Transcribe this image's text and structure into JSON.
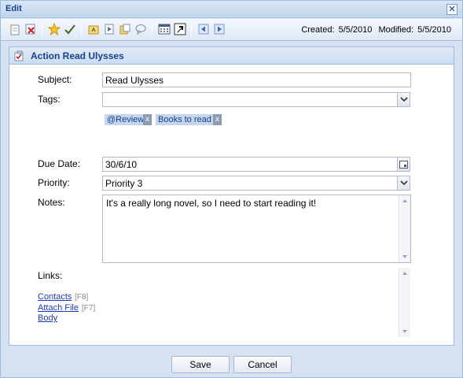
{
  "window": {
    "title": "Edit",
    "close_glyph": "✕"
  },
  "toolbar": {
    "buttons": [
      "new-item-icon",
      "delete-icon",
      "star-icon",
      "check-icon",
      "folder-up-icon",
      "move-icon",
      "copy-icon",
      "comment-icon",
      "calendar-icon",
      "external-link-icon",
      "back-icon",
      "forward-icon"
    ],
    "created_label": "Created:",
    "created_value": "5/5/2010",
    "modified_label": "Modified:",
    "modified_value": "5/5/2010"
  },
  "panel": {
    "title": "Action Read Ulysses",
    "icon": "action-icon"
  },
  "form": {
    "subject_label": "Subject:",
    "subject_value": "Read Ulysses",
    "tags_label": "Tags:",
    "tags_value": "",
    "tags": [
      {
        "label": "@Review",
        "remove": "x"
      },
      {
        "label": "Books to read",
        "remove": "x"
      }
    ],
    "due_label": "Due Date:",
    "due_value": "30/6/10",
    "priority_label": "Priority:",
    "priority_value": "Priority 3",
    "notes_label": "Notes:",
    "notes_value": "It's a really long novel, so I need to start reading it!",
    "links_label": "Links:"
  },
  "links": [
    {
      "label": "Contacts",
      "shortcut": "[F8]"
    },
    {
      "label": "Attach File",
      "shortcut": "[F7]"
    },
    {
      "label": "Body",
      "shortcut": ""
    }
  ],
  "footer": {
    "save_label": "Save",
    "cancel_label": "Cancel"
  },
  "colors": {
    "accent": "#15428b",
    "border": "#99bbe8",
    "link": "#1c3bb8"
  }
}
